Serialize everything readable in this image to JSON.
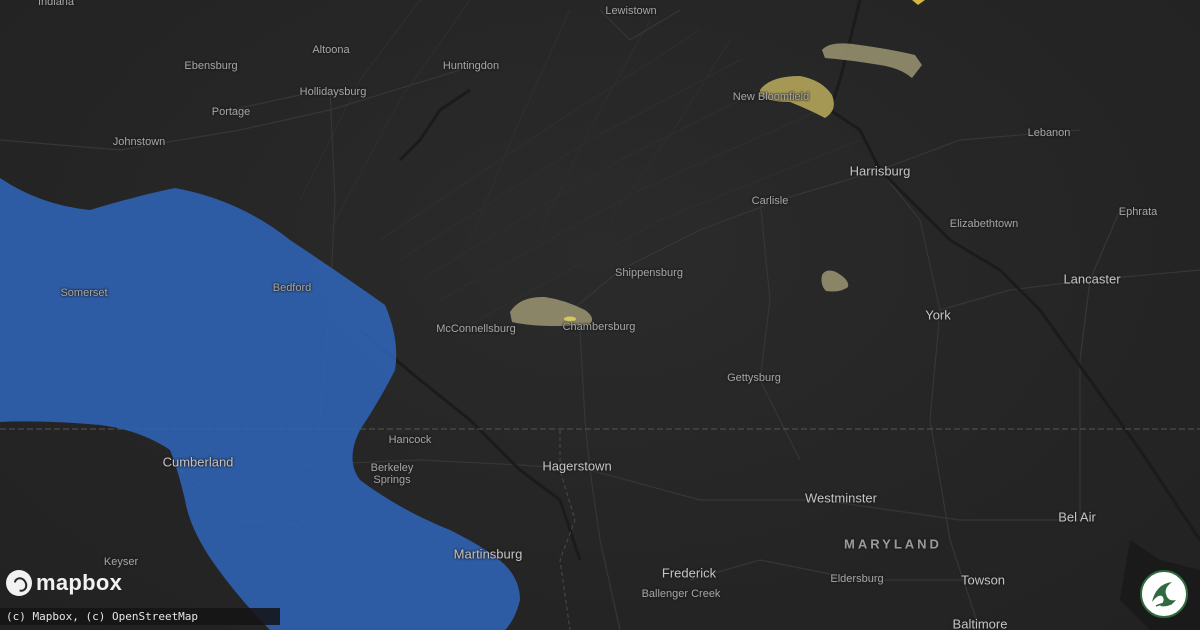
{
  "map": {
    "places": [
      {
        "id": "indiana",
        "label": "Indiana",
        "kind": "town"
      },
      {
        "id": "lewistown",
        "label": "Lewistown",
        "kind": "town"
      },
      {
        "id": "ebensburg",
        "label": "Ebensburg",
        "kind": "town"
      },
      {
        "id": "altoona",
        "label": "Altoona",
        "kind": "town"
      },
      {
        "id": "huntingdon",
        "label": "Huntingdon",
        "kind": "town"
      },
      {
        "id": "hollidaysburg",
        "label": "Hollidaysburg",
        "kind": "town"
      },
      {
        "id": "portage",
        "label": "Portage",
        "kind": "town"
      },
      {
        "id": "new-bloomfield",
        "label": "New Bloomfield",
        "kind": "town"
      },
      {
        "id": "lebanon",
        "label": "Lebanon",
        "kind": "town"
      },
      {
        "id": "johnstown",
        "label": "Johnstown",
        "kind": "town"
      },
      {
        "id": "harrisburg",
        "label": "Harrisburg",
        "kind": "city"
      },
      {
        "id": "carlisle",
        "label": "Carlisle",
        "kind": "town"
      },
      {
        "id": "ephrata",
        "label": "Ephrata",
        "kind": "town"
      },
      {
        "id": "elizabethtown",
        "label": "Elizabethtown",
        "kind": "town"
      },
      {
        "id": "shippensburg",
        "label": "Shippensburg",
        "kind": "town"
      },
      {
        "id": "lancaster",
        "label": "Lancaster",
        "kind": "city"
      },
      {
        "id": "somerset",
        "label": "Somerset",
        "kind": "town"
      },
      {
        "id": "bedford",
        "label": "Bedford",
        "kind": "town"
      },
      {
        "id": "mcconnellsburg",
        "label": "McConnellsburg",
        "kind": "town"
      },
      {
        "id": "chambersburg",
        "label": "Chambersburg",
        "kind": "town"
      },
      {
        "id": "york",
        "label": "York",
        "kind": "city"
      },
      {
        "id": "gettysburg",
        "label": "Gettysburg",
        "kind": "town"
      },
      {
        "id": "hancock",
        "label": "Hancock",
        "kind": "town"
      },
      {
        "id": "cumberland",
        "label": "Cumberland",
        "kind": "city"
      },
      {
        "id": "hagerstown",
        "label": "Hagerstown",
        "kind": "city"
      },
      {
        "id": "berkeley-springs",
        "label": "Berkeley\nSprings",
        "kind": "town"
      },
      {
        "id": "westminster",
        "label": "Westminster",
        "kind": "city"
      },
      {
        "id": "bel-air",
        "label": "Bel Air",
        "kind": "city"
      },
      {
        "id": "maryland",
        "label": "MARYLAND",
        "kind": "state"
      },
      {
        "id": "martinsburg",
        "label": "Martinsburg",
        "kind": "city"
      },
      {
        "id": "keyser",
        "label": "Keyser",
        "kind": "town"
      },
      {
        "id": "frederick",
        "label": "Frederick",
        "kind": "city"
      },
      {
        "id": "eldersburg",
        "label": "Eldersburg",
        "kind": "town"
      },
      {
        "id": "towson",
        "label": "Towson",
        "kind": "city"
      },
      {
        "id": "ballenger-creek",
        "label": "Ballenger Creek",
        "kind": "town"
      },
      {
        "id": "baltimore",
        "label": "Baltimore",
        "kind": "city"
      }
    ],
    "colors": {
      "background": "#262626",
      "warning_area": "#2f63b6",
      "hail_swath": "#9c9573",
      "hail_core": "#c9bb5a",
      "water": "#1a1a1a",
      "border": "#555555"
    }
  },
  "logo": {
    "icon": "mapbox-logo-icon",
    "text": "mapbox"
  },
  "attribution": {
    "text": "(c) Mapbox, (c) OpenStreetMap"
  },
  "badge": {
    "icon": "brand-swirl-icon"
  }
}
